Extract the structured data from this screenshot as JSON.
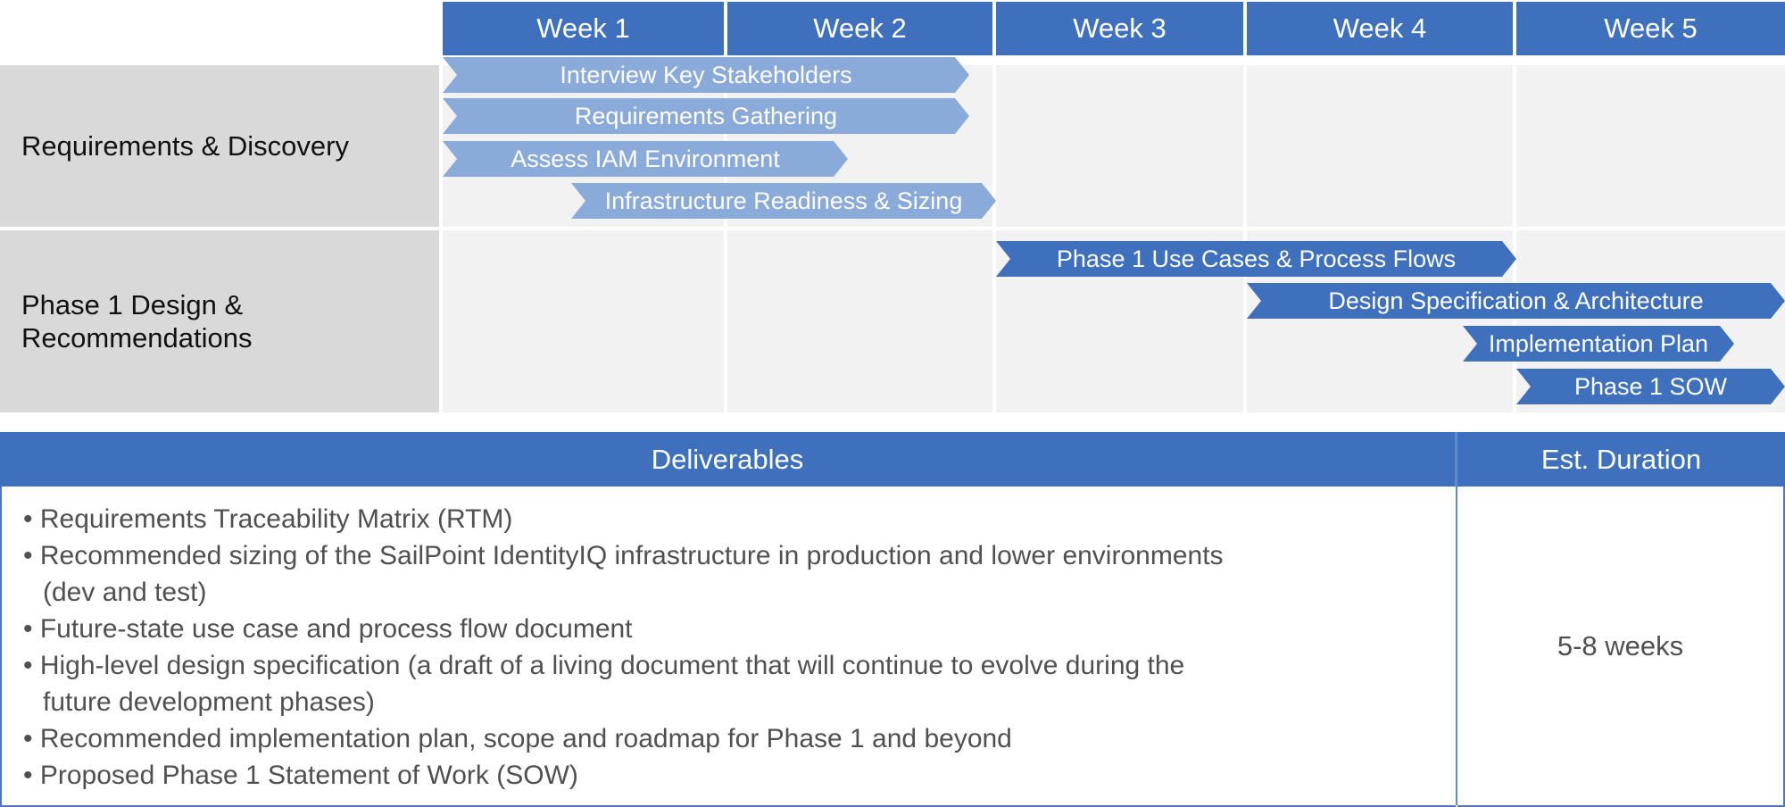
{
  "timeline": {
    "weeks": [
      "Week 1",
      "Week 2",
      "Week 3",
      "Week 4",
      "Week 5"
    ],
    "phases": [
      {
        "label": "Requirements & Discovery",
        "tasks": [
          {
            "label": "Interview Key Stakeholders",
            "start_week": 1.0,
            "end_week": 2.9,
            "color": "#8AAAD9"
          },
          {
            "label": "Requirements Gathering",
            "start_week": 1.0,
            "end_week": 2.9,
            "color": "#8AAAD9"
          },
          {
            "label": "Assess IAM Environment",
            "start_week": 1.0,
            "end_week": 2.45,
            "color": "#8AAAD9"
          },
          {
            "label": "Infrastructure Readiness & Sizing",
            "start_week": 1.45,
            "end_week": 3.0,
            "color": "#8AAAD9"
          }
        ]
      },
      {
        "label": "Phase 1 Design & Recommendations",
        "tasks": [
          {
            "label": "Phase 1 Use Cases & Process Flows",
            "start_week": 3.0,
            "end_week": 5.0,
            "color": "#3F70BD"
          },
          {
            "label": "Design Specification & Architecture",
            "start_week": 4.0,
            "end_week": 6.0,
            "color": "#3F70BD"
          },
          {
            "label": "Implementation Plan",
            "start_week": 4.8,
            "end_week": 5.8,
            "color": "#3F70BD"
          },
          {
            "label": "Phase 1 SOW",
            "start_week": 5.0,
            "end_week": 6.0,
            "color": "#3F70BD"
          }
        ]
      }
    ]
  },
  "table": {
    "headers": [
      "Deliverables",
      "Est. Duration"
    ],
    "deliverables": [
      "Requirements Traceability Matrix (RTM)",
      "Recommended sizing of the SailPoint IdentityIQ infrastructure in production and lower environments (dev and test)",
      "Future-state use case and process flow document",
      "High-level design specification (a draft of a living document that will continue to evolve during the future development phases)",
      "Recommended implementation plan, scope and roadmap for Phase 1 and beyond",
      "Proposed Phase 1 Statement of Work (SOW)"
    ],
    "duration": "5-8 weeks"
  },
  "colors": {
    "header_blue": "#3F70BD",
    "light_task_blue": "#8AAAD9",
    "phase_label_gray": "#D9D9D9",
    "cell_gray": "#F2F2F2",
    "body_text": "#505050"
  }
}
